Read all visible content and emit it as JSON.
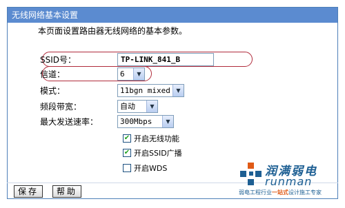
{
  "panel": {
    "title": "无线网络基本设置",
    "intro": "本页面设置路由器无线网络的基本参数。"
  },
  "fields": {
    "ssid": {
      "label": "SSID号：",
      "value": "TP-LINK_841_B"
    },
    "channel": {
      "label": "信道：",
      "value": "6"
    },
    "mode": {
      "label": "模式：",
      "value": "11bgn mixed"
    },
    "bandwidth": {
      "label": "频段带宽：",
      "value": "自动"
    },
    "max_rate": {
      "label": "最大发送速率：",
      "value": "300Mbps"
    }
  },
  "checkboxes": [
    {
      "label": "开启无线功能",
      "checked": true
    },
    {
      "label": "开启SSID广播",
      "checked": true
    },
    {
      "label": "开启WDS",
      "checked": false
    }
  ],
  "buttons": {
    "save": "保存",
    "help": "帮助"
  },
  "logo": {
    "brand_cn": "润满弱电",
    "brand_en": "runman",
    "slogan_pre": "弱电工程行业",
    "slogan_accent": "一站式",
    "slogan_post": "设计施工专家"
  },
  "colors": {
    "title_bar": "#5b8bd0",
    "highlight": "#b02a3a",
    "check": "#21a121",
    "brand": "#1d5f93"
  }
}
